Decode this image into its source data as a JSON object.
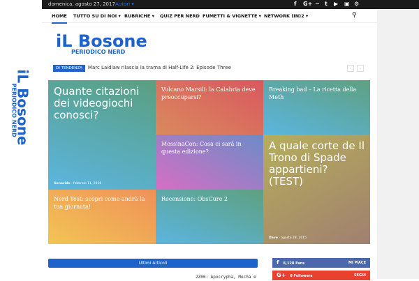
{
  "topbar": {
    "date": "domenica, agosto 27, 2017",
    "authors": "Autori ▾",
    "social": [
      "f",
      "G+",
      "~",
      "t",
      "▶",
      "▣",
      "⚙"
    ]
  },
  "side_logo": {
    "title": "iL Bosone",
    "subtitle": "PERIODICO NERD"
  },
  "nav": {
    "items": [
      "HOME",
      "TUTTO SU DI NOI ▾",
      "RUBRICHE ▾",
      "QUIZ PER NERD",
      "FUMETTI & VIGNETTE ▾",
      "NETWORK (IN)2 ▾"
    ],
    "search": "⚲"
  },
  "logo": {
    "title": "iL Bosone",
    "subtitle": "PERIODICO NERD"
  },
  "ticker": {
    "tag": "DI TENDENZA",
    "text": "Marc Laidlaw rilascia la trama di Half-Life 2: Episode Three",
    "prev": "‹",
    "next": "›"
  },
  "tiles": [
    {
      "title": "Quante citazioni dei videogiochi conosci?",
      "author": "Genocide",
      "date": "febbraio 11, 2016"
    },
    {
      "title": "Vulcano Marsili: la Calabria deve preoccuparsi?"
    },
    {
      "title": "Breaking bad – La ricetta della Meth"
    },
    {
      "title": "MessinaCon: Cosa ci sarà in questa edizione?"
    },
    {
      "title": "A quale corte de Il Trono di Spade appartieni? (TEST)",
      "author": "Dave",
      "date": "agosto 28, 2015"
    },
    {
      "title": "Nerd Test: scopri come andrà la tua giornata!"
    },
    {
      "title": "Recensione: ObsCure 2"
    }
  ],
  "latest": {
    "title": "Ultimi Articoli",
    "first": "2Z00: Apocrypha, Mecha e"
  },
  "social": [
    {
      "icon": "f",
      "count": "8,128",
      "unit": "Fans",
      "action": "MI PIACE",
      "color": "#4a69ad"
    },
    {
      "icon": "G+",
      "count": "0",
      "unit": "Followers",
      "action": "SEGUI",
      "color": "#e8412e"
    }
  ]
}
